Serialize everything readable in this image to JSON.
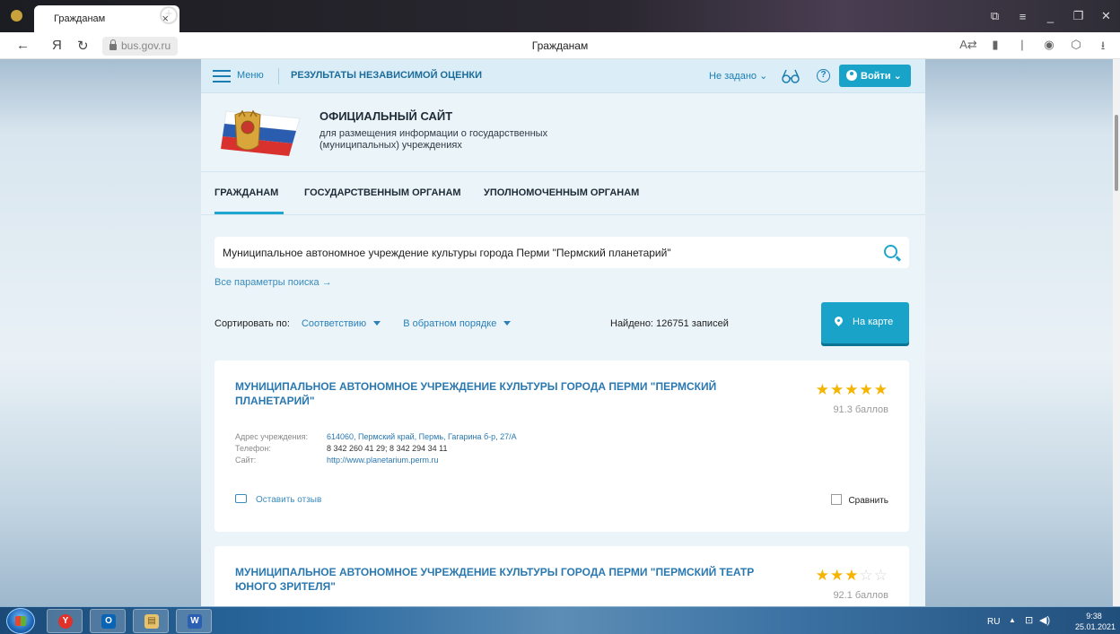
{
  "browser": {
    "tab_title": "Гражданам",
    "tab_close": "×",
    "new_tab": "+",
    "url": "bus.gov.ru",
    "page_title": "Гражданам",
    "nav_back": "←",
    "nav_yandex": "Я",
    "nav_reload": "↻",
    "right_icons": [
      "A⇄",
      "▮",
      "|",
      "◉",
      "⬡",
      "⭳"
    ],
    "window_controls": [
      "⧉",
      "≡",
      "_",
      "❐",
      "✕"
    ]
  },
  "site": {
    "topbar": {
      "menu_label": "Меню",
      "results_link": "РЕЗУЛЬТАТЫ НЕЗАВИСИМОЙ ОЦЕНКИ",
      "region": "Не задано ⌄",
      "help": "?",
      "login": "Войти ⌄"
    },
    "header": {
      "title": "ОФИЦИАЛЬНЫЙ САЙТ",
      "subtitle": "для размещения информации о государственных (муниципальных) учреждениях"
    },
    "tabs": [
      "ГРАЖДАНАМ",
      "ГОСУДАРСТВЕННЫМ ОРГАНАМ",
      "УПОЛНОМОЧЕННЫМ ОРГАНАМ"
    ],
    "search": {
      "query": "Муниципальное автономное учреждение культуры города Перми \"Пермский планетарий\"",
      "all_params": "Все параметры поиска →"
    },
    "sort": {
      "label": "Сортировать по:",
      "by": "Соответствию",
      "order": "В обратном порядке"
    },
    "found": "Найдено: 126751 записей",
    "map_button": "На карте",
    "results": [
      {
        "name": "МУНИЦИПАЛЬНОЕ АВТОНОМНОЕ УЧРЕЖДЕНИЕ КУЛЬТУРЫ ГОРОДА ПЕРМИ \"ПЕРМСКИЙ ПЛАНЕТАРИЙ\"",
        "stars_filled": "★★★★★",
        "stars_empty": "",
        "rating": 5,
        "score": "91.3 баллов",
        "address_label": "Адрес учреждения:",
        "address": "614060, Пермский край, Пермь, Гагарина б-р, 27/А",
        "phone_label": "Телефон:",
        "phone": "8 342 260 41 29; 8 342 294 34 11",
        "site_label": "Сайт:",
        "site": "http://www.planetarium.perm.ru",
        "review": "Оставить отзыв",
        "compare": "Сравнить"
      },
      {
        "name": "МУНИЦИПАЛЬНОЕ АВТОНОМНОЕ УЧРЕЖДЕНИЕ КУЛЬТУРЫ ГОРОДА ПЕРМИ \"ПЕРМСКИЙ ТЕАТР ЮНОГО ЗРИТЕЛЯ\"",
        "stars_filled": "★★★",
        "stars_empty": "☆☆",
        "rating": 3,
        "score": "92.1 баллов"
      }
    ]
  },
  "taskbar": {
    "apps": [
      "Y",
      "O",
      "▤",
      "W"
    ],
    "lang": "RU",
    "tray_arrow": "▲",
    "tray_network": "⊡",
    "tray_volume": "◀)",
    "time": "9:38",
    "date": "25.01.2021"
  },
  "colors": {
    "accent": "#19a3c9",
    "link": "#2a78b0",
    "star": "#f5b400",
    "page_bg": "#ebf4f9"
  }
}
